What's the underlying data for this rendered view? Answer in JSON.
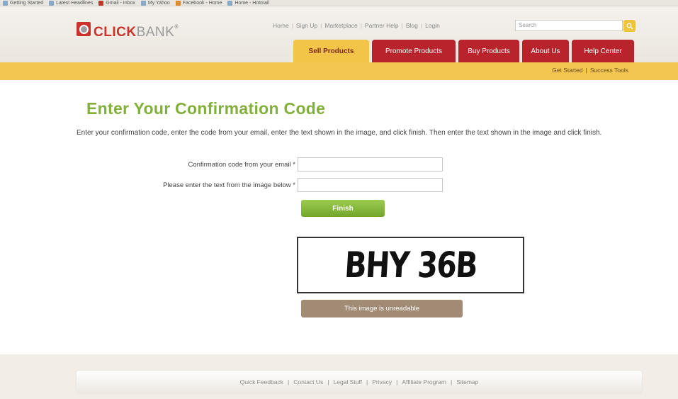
{
  "bookmarks": [
    {
      "icon": "bookmark-icon",
      "label": "Getting Started"
    },
    {
      "icon": "bookmark-icon",
      "label": "Latest Headlines"
    },
    {
      "icon": "gmail-icon",
      "label": "Gmail - Inbox"
    },
    {
      "icon": "bookmark-icon",
      "label": "My Yahoo"
    },
    {
      "icon": "bookmark-icon",
      "label": "Facebook - Home"
    },
    {
      "icon": "bookmark-icon",
      "label": "Home - Hotmail"
    }
  ],
  "header": {
    "logo_main": "CLICK",
    "logo_bank": "BANK",
    "logo_tm": "®",
    "top_links": [
      "Home",
      "Sign Up",
      "Marketplace",
      "Partner Help",
      "Blog",
      "Login"
    ],
    "search_placeholder": "Search"
  },
  "nav": {
    "tabs": [
      {
        "label": "Sell Products",
        "active": true
      },
      {
        "label": "Promote Products",
        "active": false
      },
      {
        "label": "Buy Products",
        "active": false
      },
      {
        "label": "About Us",
        "active": false
      },
      {
        "label": "Help Center",
        "active": false
      }
    ]
  },
  "subnav": {
    "links": [
      "Get Started",
      "Success Tools"
    ]
  },
  "main": {
    "title": "Enter Your Confirmation Code",
    "instructions": "Enter your confirmation code, enter the code from your email, enter the text shown in the image, and click finish. Then enter the text shown in the image and click finish.",
    "fields": [
      {
        "label": "Confirmation code from your email *",
        "value": ""
      },
      {
        "label": "Please enter the text from the image below *",
        "value": ""
      }
    ],
    "finish_label": "Finish",
    "captcha_text": "BHY 36B",
    "unreadable_label": "This image is unreadable"
  },
  "footer": {
    "links": [
      "Quick Feedback",
      "Contact Us",
      "Legal Stuff",
      "Privacy",
      "Affiliate Program",
      "Sitemap"
    ]
  },
  "colors": {
    "brand_red": "#b9232c",
    "accent_yellow": "#f2c651",
    "title_green": "#82b03a",
    "finish_green": "#7fb236",
    "unreadable_brown": "#a18b74"
  }
}
